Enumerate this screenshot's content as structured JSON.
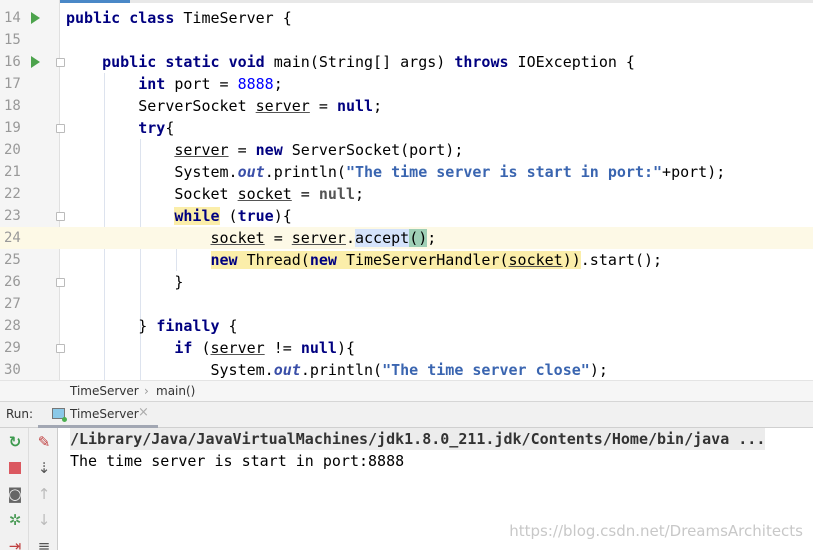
{
  "editor": {
    "current_line": 24,
    "lines": [
      {
        "n": "14",
        "run": true,
        "fold": false,
        "tokens": [
          [
            "public",
            "kw"
          ],
          [
            " "
          ],
          [
            "class",
            "kw"
          ],
          [
            " TimeServer {"
          ]
        ]
      },
      {
        "n": "15",
        "tokens": []
      },
      {
        "n": "16",
        "run": true,
        "fold": true,
        "tokens": [
          [
            "    "
          ],
          [
            "public",
            "kw"
          ],
          [
            " "
          ],
          [
            "static",
            "kw"
          ],
          [
            " "
          ],
          [
            "void",
            "kw"
          ],
          [
            " main(String[] args) "
          ],
          [
            "throws",
            "kw"
          ],
          [
            " IOException {"
          ]
        ]
      },
      {
        "n": "17",
        "tokens": [
          [
            "        "
          ],
          [
            "int",
            "kw"
          ],
          [
            " port = "
          ],
          [
            "8888",
            "num"
          ],
          [
            ";"
          ]
        ]
      },
      {
        "n": "18",
        "tokens": [
          [
            "        ServerSocket "
          ],
          [
            "server",
            "u"
          ],
          [
            " = "
          ],
          [
            "null",
            "kw"
          ],
          [
            ";"
          ]
        ]
      },
      {
        "n": "19",
        "fold": true,
        "tokens": [
          [
            "        "
          ],
          [
            "try",
            "kw"
          ],
          [
            "{"
          ]
        ]
      },
      {
        "n": "20",
        "tokens": [
          [
            "            "
          ],
          [
            "server",
            "u"
          ],
          [
            " = "
          ],
          [
            "new",
            "kw"
          ],
          [
            " ServerSocket(port);"
          ]
        ]
      },
      {
        "n": "21",
        "tokens": [
          [
            "            System."
          ],
          [
            "out",
            "fld"
          ],
          [
            ".println("
          ],
          [
            "\"The time server is start in port:\"",
            "str"
          ],
          [
            "+port);"
          ]
        ]
      },
      {
        "n": "22",
        "tokens": [
          [
            "            Socket "
          ],
          [
            "socket",
            "u"
          ],
          [
            " = "
          ],
          [
            "null",
            "nul"
          ],
          [
            ";"
          ]
        ]
      },
      {
        "n": "23",
        "fold": true,
        "tokens": [
          [
            "            "
          ],
          [
            "while",
            "kw hl"
          ],
          [
            " ("
          ],
          [
            "true",
            "kw"
          ],
          [
            "){"
          ]
        ]
      },
      {
        "n": "24",
        "tokens": [
          [
            "                "
          ],
          [
            "socket",
            "u"
          ],
          [
            " = "
          ],
          [
            "server",
            "u"
          ],
          [
            "."
          ],
          [
            "accept",
            "hb"
          ],
          [
            "()",
            "hg"
          ],
          [
            ";"
          ]
        ]
      },
      {
        "n": "25",
        "tokens": [
          [
            "                "
          ],
          [
            "new",
            "kw hl"
          ],
          [
            " Thread(",
            "hl"
          ],
          [
            "new",
            "kw hl"
          ],
          [
            " TimeServerHandler(",
            "hl"
          ],
          [
            "socket",
            "u hl"
          ],
          [
            "))",
            "hl"
          ],
          [
            ".start();"
          ]
        ]
      },
      {
        "n": "26",
        "fold": true,
        "tokens": [
          [
            "            }"
          ]
        ]
      },
      {
        "n": "27",
        "tokens": []
      },
      {
        "n": "28",
        "tokens": [
          [
            "        } "
          ],
          [
            "finally",
            "kw"
          ],
          [
            " {"
          ]
        ]
      },
      {
        "n": "29",
        "fold": true,
        "tokens": [
          [
            "            "
          ],
          [
            "if",
            "kw"
          ],
          [
            " ("
          ],
          [
            "server",
            "u"
          ],
          [
            " != "
          ],
          [
            "null",
            "kw"
          ],
          [
            "){"
          ]
        ]
      },
      {
        "n": "30",
        "tokens": [
          [
            "                System."
          ],
          [
            "out",
            "fld"
          ],
          [
            ".println("
          ],
          [
            "\"The time server close\"",
            "str"
          ],
          [
            ");"
          ]
        ]
      }
    ]
  },
  "breadcrumb": {
    "items": [
      "TimeServer",
      "main()"
    ],
    "separator": "›"
  },
  "run_panel": {
    "label": "Run:",
    "tab": "TimeServer",
    "close": "×",
    "toolbar_left": [
      "rerun-icon",
      "stop-icon",
      "camera-icon",
      "debug-icon",
      "restore-layout-icon"
    ],
    "toolbar_right": [
      "clear-icon",
      "sort-icon",
      "up-arrow-icon",
      "down-arrow-icon",
      "soft-wrap-icon"
    ],
    "console": [
      "/Library/Java/JavaVirtualMachines/jdk1.8.0_211.jdk/Contents/Home/bin/java ...",
      "The time server is start in port:8888"
    ]
  },
  "watermark": "https://blog.csdn.net/DreamsArchitects"
}
